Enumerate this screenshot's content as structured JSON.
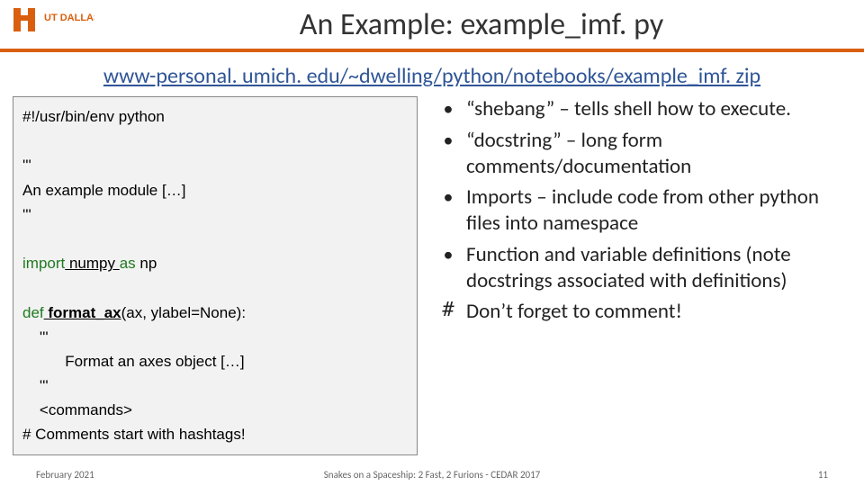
{
  "header": {
    "logo_text": "UT DALLAS",
    "title": "An Example: example_imf. py"
  },
  "url": "www-personal. umich. edu/~dwelling/python/notebooks/example_imf. zip",
  "code": {
    "l1": "#!/usr/bin/env python",
    "l2_a": "'''",
    "l3": "An example module […]",
    "l3b": "'''",
    "l4_kw": "import",
    "l4_mid": " numpy ",
    "l4_as": "as",
    "l4_np": " np",
    "l5_def": "def",
    "l5_name": " format_ax",
    "l5_args": "(ax, ylabel=None):",
    "l6": "    '''",
    "l7": "          Format an axes object […]",
    "l8": "    '''",
    "l9": "    <commands>",
    "l10": "# Comments start with hashtags!"
  },
  "bullets": [
    {
      "marker": "•",
      "text": "“shebang” – tells shell how to execute."
    },
    {
      "marker": "•",
      "text": "“docstring” – long form comments/documentation"
    },
    {
      "marker": "•",
      "text": "Imports – include code from other python files into namespace"
    },
    {
      "marker": "•",
      "text": "Function and variable definitions (note docstrings associated with definitions)"
    },
    {
      "marker": "#",
      "text": "Don’t forget to comment!"
    }
  ],
  "footer": {
    "left": "February 2021",
    "center": "Snakes on a Spaceship: 2 Fast, 2 Furions - CEDAR 2017",
    "right": "11"
  }
}
